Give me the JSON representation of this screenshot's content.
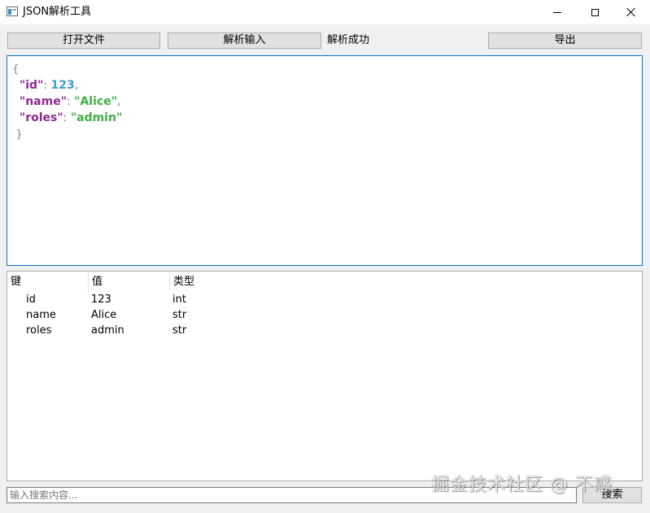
{
  "window": {
    "title": "JSON解析工具",
    "icon": "app-window-icon",
    "controls": [
      "minimize-icon",
      "maximize-icon",
      "close-icon"
    ]
  },
  "toolbar": {
    "open_label": "打开文件",
    "parse_label": "解析输入",
    "status": "解析成功",
    "export_label": "导出"
  },
  "editor": {
    "open_brace": "{",
    "close_brace": "}",
    "entries": [
      {
        "key": "\"id\"",
        "value": "123",
        "kind": "number",
        "trail": ","
      },
      {
        "key": "\"name\"",
        "value": "\"Alice\"",
        "kind": "string",
        "trail": ","
      },
      {
        "key": "\"roles\"",
        "value": "\"admin\"",
        "kind": "string",
        "trail": ""
      }
    ]
  },
  "tree": {
    "headers": [
      "键",
      "值",
      "类型"
    ],
    "rows": [
      {
        "key": "id",
        "value": "123",
        "type": "int"
      },
      {
        "key": "name",
        "value": "Alice",
        "type": "str"
      },
      {
        "key": "roles",
        "value": "admin",
        "type": "str"
      }
    ]
  },
  "search": {
    "placeholder": "输入搜索内容...",
    "button_label": "搜索"
  },
  "watermark": "掘金技术社区 @ 不惑",
  "colors": {
    "key": "#8e2a91",
    "number": "#3ca0d0",
    "string": "#3cb040",
    "punct": "#808080",
    "focus_border": "#0078d7"
  }
}
